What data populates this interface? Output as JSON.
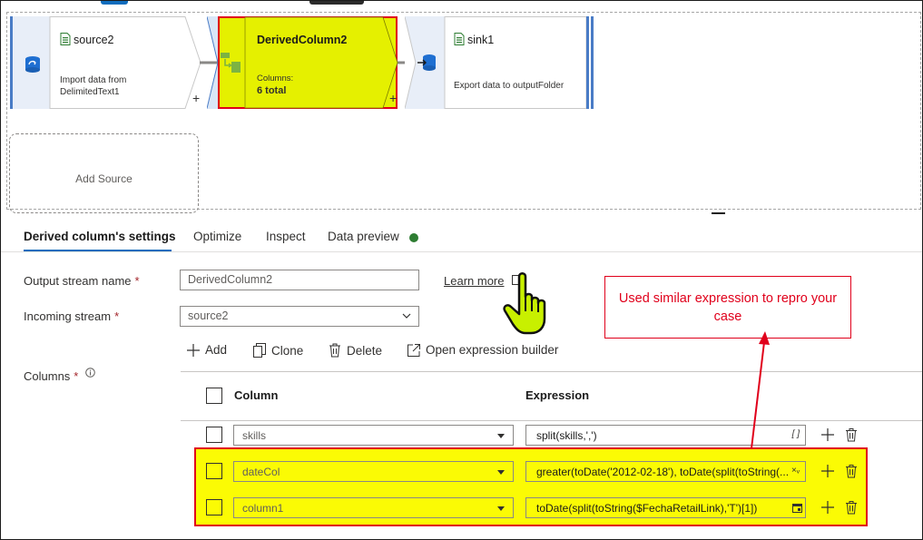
{
  "canvas": {
    "nodes": {
      "source": {
        "title": "source2",
        "description": "Import data from DelimitedText1"
      },
      "derived": {
        "title": "DerivedColumn2",
        "columns_label": "Columns:",
        "columns_value": "6 total"
      },
      "sink": {
        "title": "sink1",
        "description": "Export data to outputFolder"
      }
    },
    "plus_glyph": "+",
    "add_source_label": "Add Source"
  },
  "tabs": [
    {
      "label": "Derived column's settings"
    },
    {
      "label": "Optimize"
    },
    {
      "label": "Inspect"
    },
    {
      "label": "Data preview"
    }
  ],
  "form": {
    "output_stream_label": "Output stream name",
    "output_stream_value": "DerivedColumn2",
    "learn_more": "Learn more",
    "incoming_stream_label": "Incoming stream",
    "incoming_stream_value": "source2",
    "columns_label": "Columns",
    "required_mark": "*"
  },
  "toolbar": {
    "add": "Add",
    "clone": "Clone",
    "delete": "Delete",
    "open_builder": "Open expression builder"
  },
  "table": {
    "headers": {
      "column": "Column",
      "expression": "Expression"
    },
    "rows": [
      {
        "column": "skills",
        "expression": "split(skills,',')",
        "icon": "[ ]"
      },
      {
        "column": "dateCol",
        "expression": "greater(toDate('2012-02-18'), toDate(split(toString(...",
        "icon": "×ᵥ"
      },
      {
        "column": "column1",
        "expression": "toDate(split(toString($FechaRetailLink),'T')[1])",
        "icon": "calendar"
      }
    ]
  },
  "annotation": {
    "callout_text": "Used similar expression to repro your case"
  },
  "colors": {
    "highlight_yellow": "#fbfb04",
    "annotation_red": "#e0001b",
    "accent_blue": "#0f6cbd",
    "status_green": "#2e7d32"
  }
}
